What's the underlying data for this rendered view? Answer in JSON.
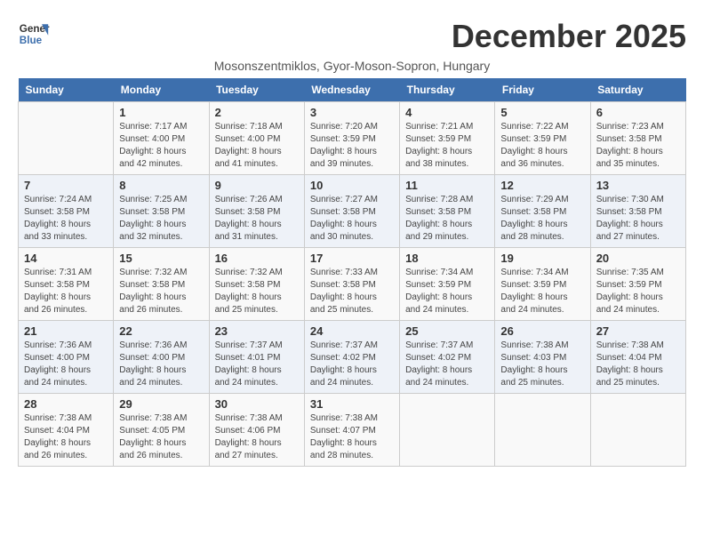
{
  "header": {
    "logo_line1": "General",
    "logo_line2": "Blue",
    "month_title": "December 2025",
    "subtitle": "Mosonszentmiklos, Gyor-Moson-Sopron, Hungary"
  },
  "days_of_week": [
    "Sunday",
    "Monday",
    "Tuesday",
    "Wednesday",
    "Thursday",
    "Friday",
    "Saturday"
  ],
  "weeks": [
    [
      {
        "day": "",
        "info": ""
      },
      {
        "day": "1",
        "info": "Sunrise: 7:17 AM\nSunset: 4:00 PM\nDaylight: 8 hours\nand 42 minutes."
      },
      {
        "day": "2",
        "info": "Sunrise: 7:18 AM\nSunset: 4:00 PM\nDaylight: 8 hours\nand 41 minutes."
      },
      {
        "day": "3",
        "info": "Sunrise: 7:20 AM\nSunset: 3:59 PM\nDaylight: 8 hours\nand 39 minutes."
      },
      {
        "day": "4",
        "info": "Sunrise: 7:21 AM\nSunset: 3:59 PM\nDaylight: 8 hours\nand 38 minutes."
      },
      {
        "day": "5",
        "info": "Sunrise: 7:22 AM\nSunset: 3:59 PM\nDaylight: 8 hours\nand 36 minutes."
      },
      {
        "day": "6",
        "info": "Sunrise: 7:23 AM\nSunset: 3:58 PM\nDaylight: 8 hours\nand 35 minutes."
      }
    ],
    [
      {
        "day": "7",
        "info": "Sunrise: 7:24 AM\nSunset: 3:58 PM\nDaylight: 8 hours\nand 33 minutes."
      },
      {
        "day": "8",
        "info": "Sunrise: 7:25 AM\nSunset: 3:58 PM\nDaylight: 8 hours\nand 32 minutes."
      },
      {
        "day": "9",
        "info": "Sunrise: 7:26 AM\nSunset: 3:58 PM\nDaylight: 8 hours\nand 31 minutes."
      },
      {
        "day": "10",
        "info": "Sunrise: 7:27 AM\nSunset: 3:58 PM\nDaylight: 8 hours\nand 30 minutes."
      },
      {
        "day": "11",
        "info": "Sunrise: 7:28 AM\nSunset: 3:58 PM\nDaylight: 8 hours\nand 29 minutes."
      },
      {
        "day": "12",
        "info": "Sunrise: 7:29 AM\nSunset: 3:58 PM\nDaylight: 8 hours\nand 28 minutes."
      },
      {
        "day": "13",
        "info": "Sunrise: 7:30 AM\nSunset: 3:58 PM\nDaylight: 8 hours\nand 27 minutes."
      }
    ],
    [
      {
        "day": "14",
        "info": "Sunrise: 7:31 AM\nSunset: 3:58 PM\nDaylight: 8 hours\nand 26 minutes."
      },
      {
        "day": "15",
        "info": "Sunrise: 7:32 AM\nSunset: 3:58 PM\nDaylight: 8 hours\nand 26 minutes."
      },
      {
        "day": "16",
        "info": "Sunrise: 7:32 AM\nSunset: 3:58 PM\nDaylight: 8 hours\nand 25 minutes."
      },
      {
        "day": "17",
        "info": "Sunrise: 7:33 AM\nSunset: 3:58 PM\nDaylight: 8 hours\nand 25 minutes."
      },
      {
        "day": "18",
        "info": "Sunrise: 7:34 AM\nSunset: 3:59 PM\nDaylight: 8 hours\nand 24 minutes."
      },
      {
        "day": "19",
        "info": "Sunrise: 7:34 AM\nSunset: 3:59 PM\nDaylight: 8 hours\nand 24 minutes."
      },
      {
        "day": "20",
        "info": "Sunrise: 7:35 AM\nSunset: 3:59 PM\nDaylight: 8 hours\nand 24 minutes."
      }
    ],
    [
      {
        "day": "21",
        "info": "Sunrise: 7:36 AM\nSunset: 4:00 PM\nDaylight: 8 hours\nand 24 minutes."
      },
      {
        "day": "22",
        "info": "Sunrise: 7:36 AM\nSunset: 4:00 PM\nDaylight: 8 hours\nand 24 minutes."
      },
      {
        "day": "23",
        "info": "Sunrise: 7:37 AM\nSunset: 4:01 PM\nDaylight: 8 hours\nand 24 minutes."
      },
      {
        "day": "24",
        "info": "Sunrise: 7:37 AM\nSunset: 4:02 PM\nDaylight: 8 hours\nand 24 minutes."
      },
      {
        "day": "25",
        "info": "Sunrise: 7:37 AM\nSunset: 4:02 PM\nDaylight: 8 hours\nand 24 minutes."
      },
      {
        "day": "26",
        "info": "Sunrise: 7:38 AM\nSunset: 4:03 PM\nDaylight: 8 hours\nand 25 minutes."
      },
      {
        "day": "27",
        "info": "Sunrise: 7:38 AM\nSunset: 4:04 PM\nDaylight: 8 hours\nand 25 minutes."
      }
    ],
    [
      {
        "day": "28",
        "info": "Sunrise: 7:38 AM\nSunset: 4:04 PM\nDaylight: 8 hours\nand 26 minutes."
      },
      {
        "day": "29",
        "info": "Sunrise: 7:38 AM\nSunset: 4:05 PM\nDaylight: 8 hours\nand 26 minutes."
      },
      {
        "day": "30",
        "info": "Sunrise: 7:38 AM\nSunset: 4:06 PM\nDaylight: 8 hours\nand 27 minutes."
      },
      {
        "day": "31",
        "info": "Sunrise: 7:38 AM\nSunset: 4:07 PM\nDaylight: 8 hours\nand 28 minutes."
      },
      {
        "day": "",
        "info": ""
      },
      {
        "day": "",
        "info": ""
      },
      {
        "day": "",
        "info": ""
      }
    ]
  ]
}
